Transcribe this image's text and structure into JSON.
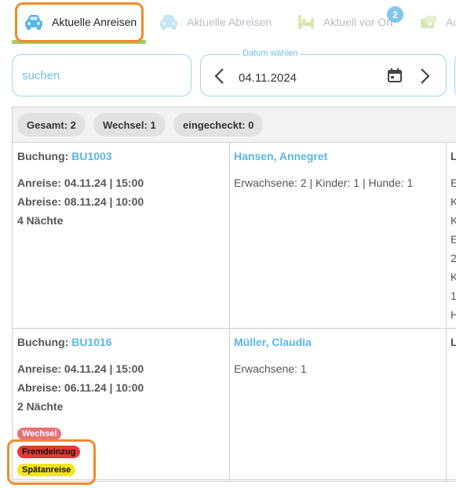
{
  "tabs": [
    {
      "label": "Aktuelle Anreisen",
      "icon": "car-icon",
      "active": true
    },
    {
      "label": "Aktuelle Abreisen",
      "icon": "car-icon",
      "active": false
    },
    {
      "label": "Aktuell vor Ort",
      "icon": "bed-icon",
      "active": false,
      "badge": "2"
    },
    {
      "label": "Au",
      "icon": "card-icon",
      "active": false
    }
  ],
  "search": {
    "placeholder": "suchen",
    "value": ""
  },
  "date": {
    "legend": "Datum wählen",
    "value": "04.11.2024"
  },
  "summary": [
    {
      "label": "Gesamt: 2"
    },
    {
      "label": "Wechsel: 1"
    },
    {
      "label": "eingecheckt: 0"
    }
  ],
  "bookings": [
    {
      "booking_label": "Buchung:",
      "booking_id": "BU1003",
      "arrival": "Anreise: 04.11.24 | 15:00",
      "departure": "Abreise: 08.11.24 | 10:00",
      "nights": "4 Nächte",
      "guest": "Hansen, Annegret",
      "persons": "Erwachsene: 2 | Kinder: 1 | Hunde: 1",
      "col3_head": "L",
      "col3_lines": [
        "E",
        "K",
        "K",
        "E",
        "2",
        "K",
        "1",
        "H"
      ],
      "tags": []
    },
    {
      "booking_label": "Buchung:",
      "booking_id": "BU1016",
      "arrival": "Anreise: 04.11.24 | 15:00",
      "departure": "Abreise: 06.11.24 | 10:00",
      "nights": "2 Nächte",
      "guest": "Müller, Claudia",
      "persons": "Erwachsene: 1",
      "col3_head": "L",
      "col3_lines": [],
      "tags": [
        {
          "label": "Wechsel",
          "bg": "#e57373",
          "color": "#ffffff"
        },
        {
          "label": "Fremdeinzug",
          "bg": "#e53935",
          "color": "#111111"
        },
        {
          "label": "Spätanreise",
          "bg": "#f5e51b",
          "color": "#111111"
        }
      ]
    }
  ],
  "colors": {
    "accent": "#5ab6e3",
    "highlight": "#f08a2c",
    "active_underline": "#9ccc65"
  }
}
